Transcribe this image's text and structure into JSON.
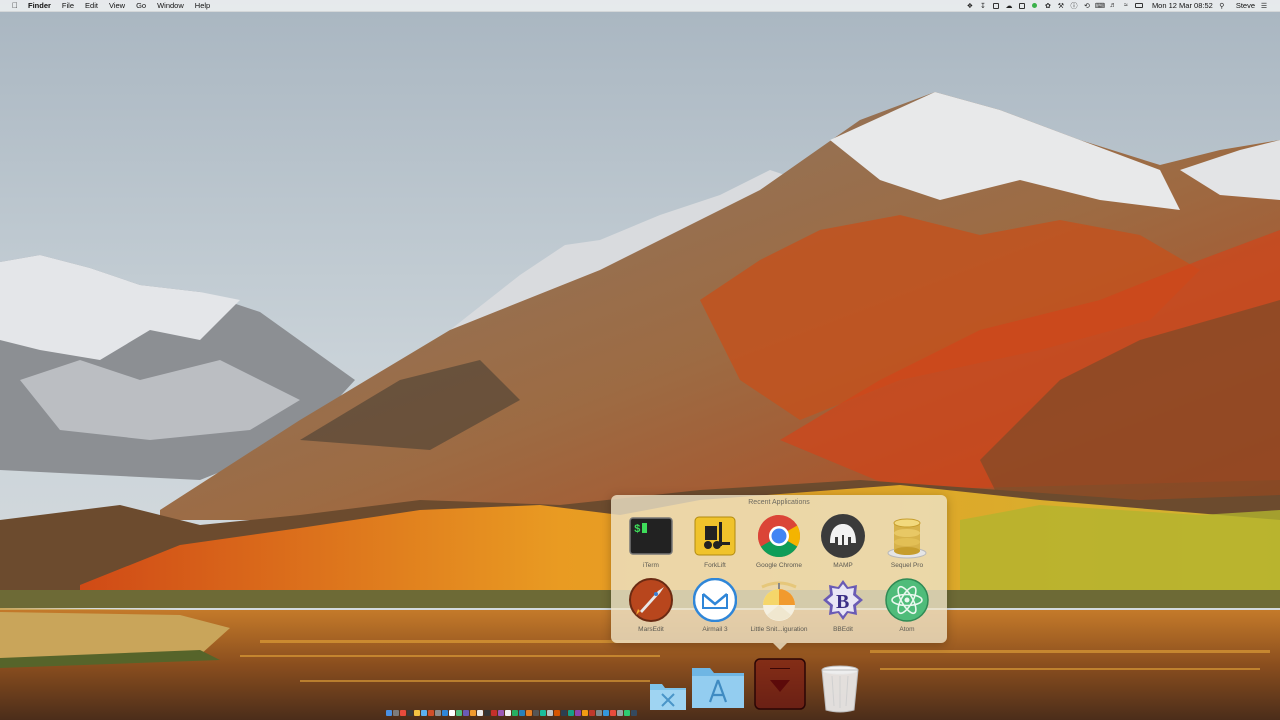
{
  "menubar": {
    "apple_icon": "apple-logo-icon",
    "app_name": "Finder",
    "menus": [
      "File",
      "Edit",
      "View",
      "Go",
      "Window",
      "Help"
    ],
    "status_icons": [
      "dropbox-icon",
      "download-icon",
      "screen-icon",
      "cloud-icon",
      "window-icon",
      "status-dot-icon",
      "fan-icon",
      "wrench-icon",
      "info-icon",
      "time-machine-icon",
      "keyboard-icon",
      "volume-icon",
      "wifi-icon",
      "battery-icon"
    ],
    "clock": "Mon 12 Mar  08:52",
    "user": "Steve"
  },
  "recent_apps": {
    "title": "Recent Applications",
    "apps": [
      {
        "label": "iTerm",
        "icon": "iterm-icon"
      },
      {
        "label": "ForkLift",
        "icon": "forklift-icon"
      },
      {
        "label": "Google Chrome",
        "icon": "chrome-icon"
      },
      {
        "label": "MAMP",
        "icon": "mamp-elephant-icon"
      },
      {
        "label": "Sequel Pro",
        "icon": "database-icon"
      },
      {
        "label": "MarsEdit",
        "icon": "rocket-icon"
      },
      {
        "label": "Airmail 3",
        "icon": "mail-icon"
      },
      {
        "label": "Little Snit...iguration",
        "icon": "little-snitch-icon"
      },
      {
        "label": "BBEdit",
        "icon": "bbedit-icon"
      },
      {
        "label": "Atom",
        "icon": "atom-icon"
      }
    ]
  },
  "dock": {
    "items": [
      "utilities-folder-icon",
      "applications-folder-icon",
      "recent-applications-stack-icon",
      "trash-icon"
    ]
  },
  "colors": {
    "popover_bg": "#eee4c8",
    "stack_accent": "#7a1111"
  }
}
